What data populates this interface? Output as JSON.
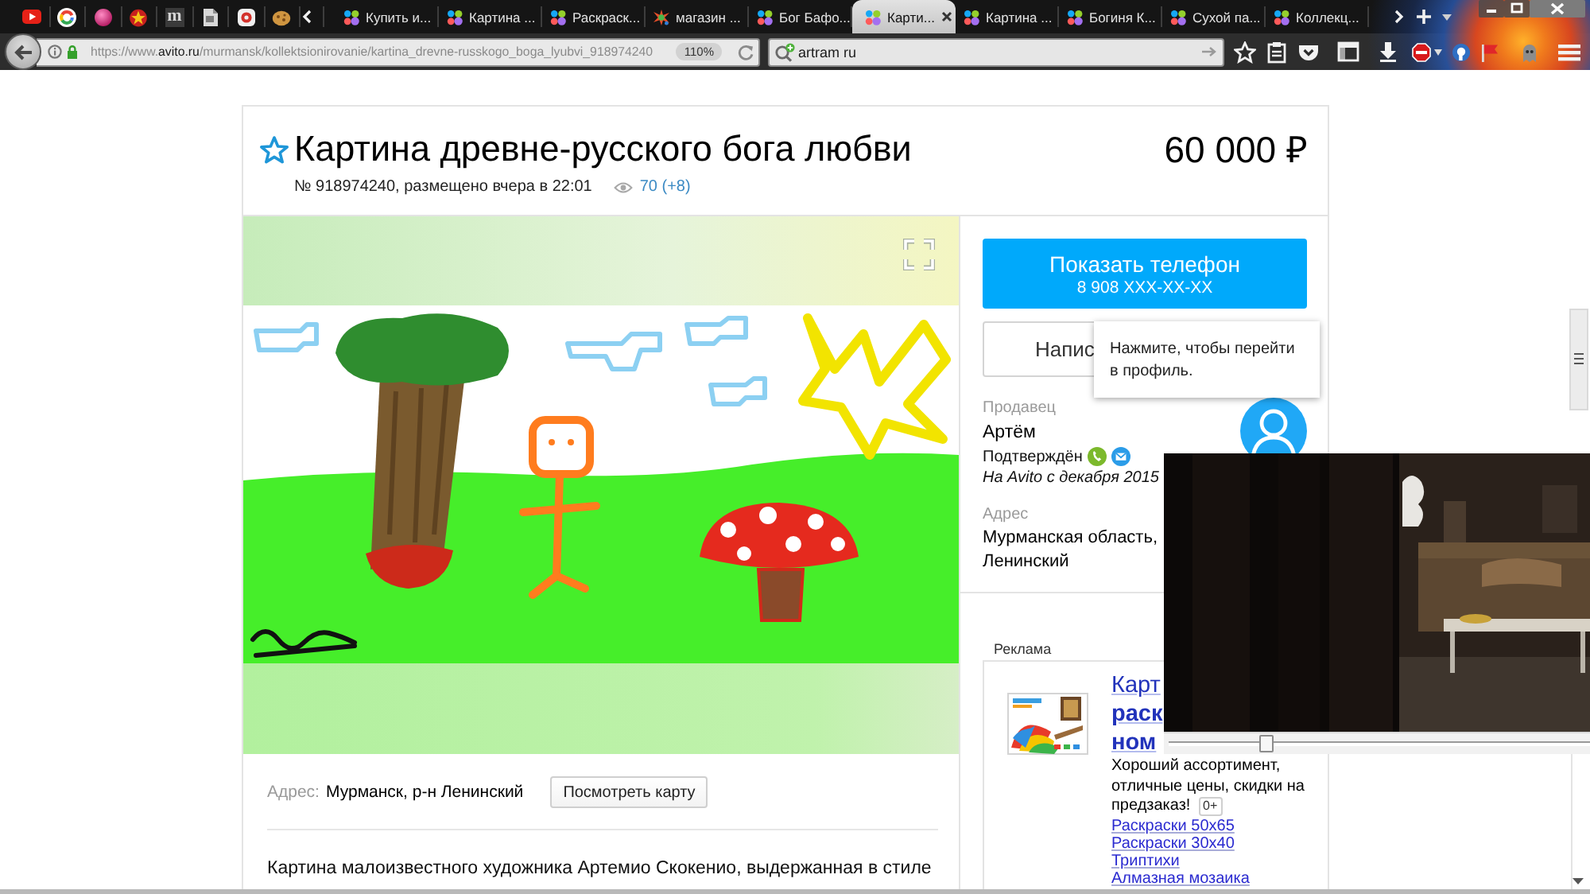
{
  "browser": {
    "pinned_tabs": [
      {
        "kind": "video"
      },
      {
        "kind": "ring"
      },
      {
        "kind": "orb"
      },
      {
        "kind": "emblem"
      },
      {
        "kind": "letter",
        "glyph": "m"
      },
      {
        "kind": "page"
      },
      {
        "kind": "tile"
      },
      {
        "kind": "cookie"
      }
    ],
    "tabs": [
      {
        "label": "Купить и...",
        "kind": "dots",
        "selected": false
      },
      {
        "label": "Картина ...",
        "kind": "dots",
        "selected": false
      },
      {
        "label": "Раскраск...",
        "kind": "dots",
        "selected": false
      },
      {
        "label": "магазин ...",
        "kind": "burst",
        "selected": false
      },
      {
        "label": "Бог Бафо...",
        "kind": "dots",
        "selected": false
      },
      {
        "label": "Карти...",
        "kind": "dots",
        "selected": true
      },
      {
        "label": "Картина ...",
        "kind": "dots",
        "selected": false
      },
      {
        "label": "Богиня К...",
        "kind": "dots",
        "selected": false
      },
      {
        "label": "Сухой па...",
        "kind": "dots",
        "selected": false
      },
      {
        "label": "Коллекц...",
        "kind": "dots",
        "selected": false
      }
    ],
    "address_bar": {
      "url": "https://www.**avito.ru**/murmansk/kollektsionirovanie/kartina_drevne-russkogo_boga_lyubvi_918974240",
      "zoom": "110%"
    },
    "search_field": {
      "value": "artram ru"
    }
  },
  "listing": {
    "favorite": false,
    "title": "Картина древне-русского бога любви",
    "price": "60 000 ₽",
    "meta": "№ 918974240, размещено вчера в 22:01",
    "views": "70 (+8)"
  },
  "location": {
    "label": "Адрес:",
    "value": "Мурманск, р-н Ленинский",
    "map_button": "Посмотреть карту"
  },
  "description": "Картина малоизвестного художника Артемио Скокенио, выдержанная в стиле",
  "contact": {
    "phone_button": {
      "label": "Показать телефон",
      "number": "8 908 XXX-XX-XX"
    },
    "message_button": "Напис",
    "tooltip": "Нажмите, чтобы перейти в профиль."
  },
  "seller": {
    "label": "Продавец",
    "name": "Артём",
    "status": "Подтверждён",
    "since": "На Avito с декабря 2015",
    "address_label": "Адрес",
    "address_lines": [
      "Мурманская область,",
      "Ленинский"
    ]
  },
  "ad": {
    "label": "Реклама",
    "title": "Карт **раск** **ном**",
    "text": "Хороший ассортимент, отличные цены, скидки на предзаказ!",
    "age": "0+",
    "links": [
      "Раскраски 50х65",
      "Раскраски 30х40",
      "Триптихи",
      "Алмазная мозаика"
    ]
  },
  "video": {
    "level": 0.23
  }
}
